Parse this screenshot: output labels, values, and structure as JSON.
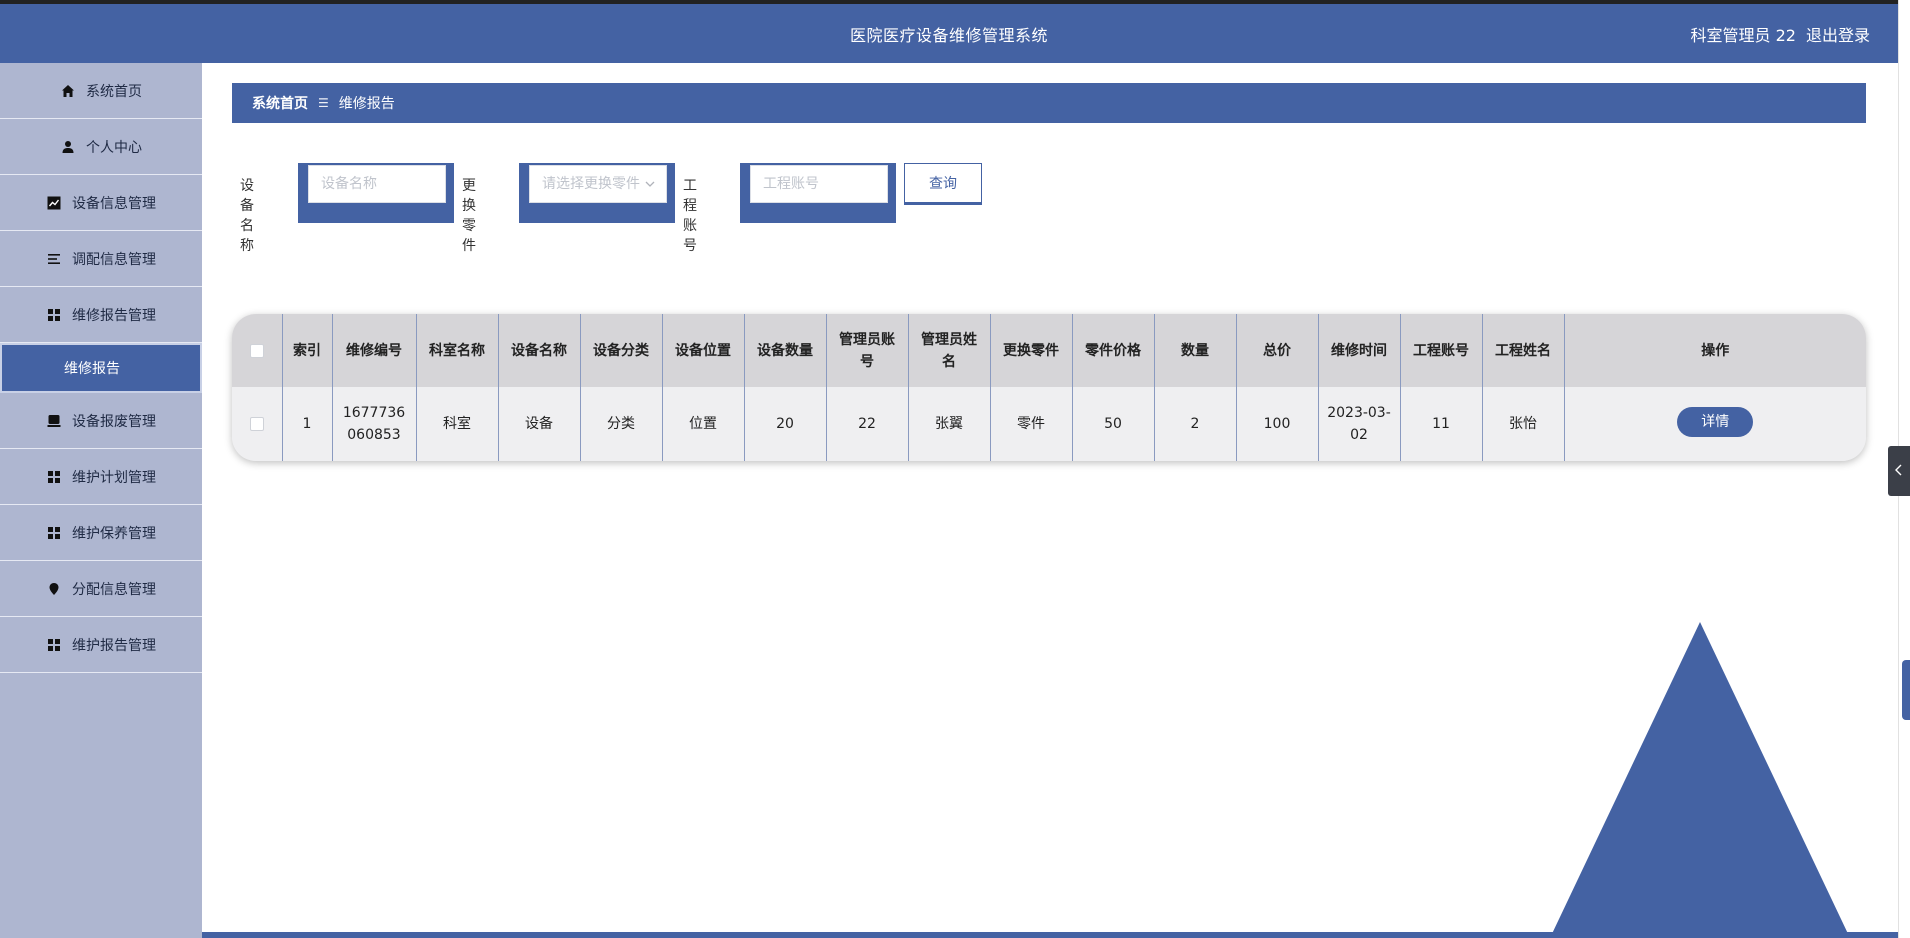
{
  "header": {
    "title": "医院医疗设备维修管理系统",
    "user_label": "科室管理员 22",
    "logout_label": "退出登录"
  },
  "sidebar": {
    "items": [
      {
        "label": "系统首页",
        "icon": "home-icon"
      },
      {
        "label": "个人中心",
        "icon": "user-icon"
      },
      {
        "label": "设备信息管理",
        "icon": "chart-icon"
      },
      {
        "label": "调配信息管理",
        "icon": "list-icon"
      },
      {
        "label": "维修报告管理",
        "icon": "grid-icon"
      },
      {
        "label": "维修报告",
        "icon": "",
        "active": true
      },
      {
        "label": "设备报废管理",
        "icon": "device-icon"
      },
      {
        "label": "维护计划管理",
        "icon": "grid-icon"
      },
      {
        "label": "维护保养管理",
        "icon": "grid-icon"
      },
      {
        "label": "分配信息管理",
        "icon": "pin-icon"
      },
      {
        "label": "维护报告管理",
        "icon": "grid-icon"
      }
    ]
  },
  "breadcrumb": {
    "home": "系统首页",
    "separator": "☰",
    "current": "维修报告"
  },
  "search": {
    "device_name_label": "设备名称",
    "device_name_placeholder": "设备名称",
    "parts_label": "更换零件",
    "parts_placeholder": "请选择更换零件",
    "engineer_label": "工程账号",
    "engineer_placeholder": "工程账号",
    "query_label": "查询"
  },
  "table": {
    "headers": [
      "索引",
      "维修编号",
      "科室名称",
      "设备名称",
      "设备分类",
      "设备位置",
      "设备数量",
      "管理员账号",
      "管理员姓名",
      "更换零件",
      "零件价格",
      "数量",
      "总价",
      "维修时间",
      "工程账号",
      "工程姓名",
      "操作"
    ],
    "rows": [
      {
        "index": "1",
        "repair_no": "1677736060853",
        "dept": "科室",
        "device": "设备",
        "category": "分类",
        "location": "位置",
        "qty": "20",
        "admin_account": "22",
        "admin_name": "张翼",
        "part": "零件",
        "part_price": "50",
        "count": "2",
        "total": "100",
        "repair_time": "2023-03-02",
        "engineer_account": "11",
        "engineer_name": "张怡",
        "action": "详情"
      }
    ]
  },
  "colors": {
    "primary": "#4462a3",
    "sidebar_bg": "#aeb6d0",
    "table_header": "#d6d5d8",
    "table_row": "#efeff1"
  }
}
